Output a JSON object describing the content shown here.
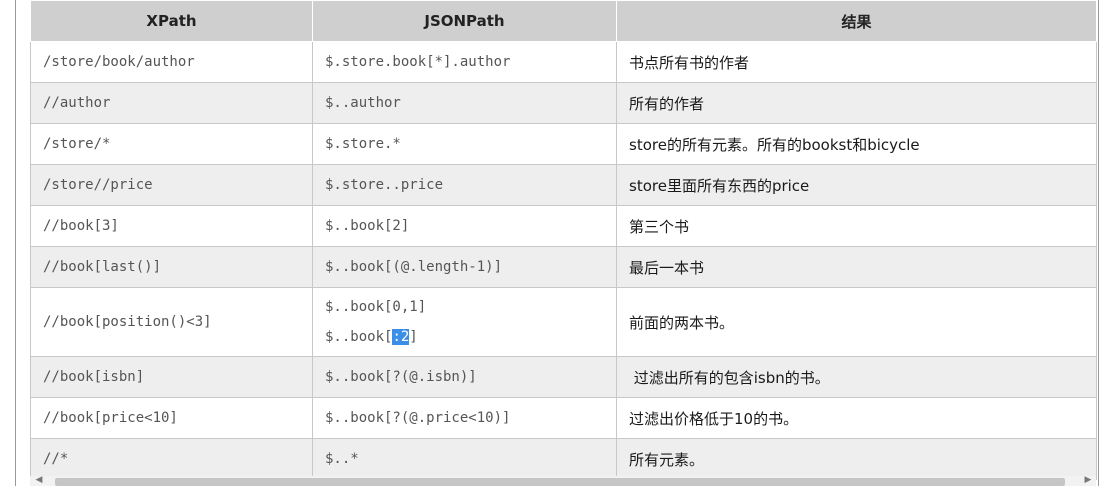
{
  "table": {
    "headers": [
      "XPath",
      "JSONPath",
      "结果"
    ],
    "rows": [
      {
        "xpath": "/store/book/author",
        "jsonpath": "$.store.book[*].author",
        "result": "书点所有书的作者"
      },
      {
        "xpath": "//author",
        "jsonpath": "$..author",
        "result": "所有的作者"
      },
      {
        "xpath": "/store/*",
        "jsonpath": "$.store.*",
        "result": "store的所有元素。所有的bookst和bicycle"
      },
      {
        "xpath": "/store//price",
        "jsonpath": "$.store..price",
        "result": "store里面所有东西的price"
      },
      {
        "xpath": "//book[3]",
        "jsonpath": "$..book[2]",
        "result": "第三个书"
      },
      {
        "xpath": "//book[last()]",
        "jsonpath": "$..book[(@.length-1)]",
        "result": "最后一本书"
      },
      {
        "xpath": "//book[position()<3]",
        "jsonpath_line1": "$..book[0,1]",
        "jsonpath_line2_before": "$..book[",
        "jsonpath_line2_selected": ":2",
        "jsonpath_line2_after": "]",
        "result": "前面的两本书。"
      },
      {
        "xpath": "//book[isbn]",
        "jsonpath": "$..book[?(@.isbn)]",
        "result": " 过滤出所有的包含isbn的书。"
      },
      {
        "xpath": "//book[price<10]",
        "jsonpath": "$..book[?(@.price<10)]",
        "result": "过滤出价格低于10的书。"
      },
      {
        "xpath": "//*",
        "jsonpath": "$..*",
        "result": "所有元素。"
      }
    ]
  },
  "scrollbar": {
    "left_arrow": "◀",
    "right_arrow": "▶"
  }
}
